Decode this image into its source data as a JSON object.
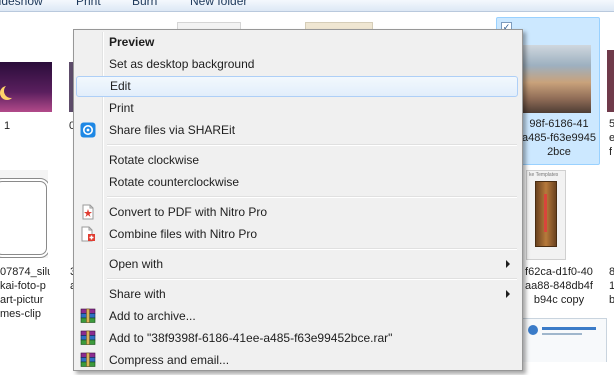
{
  "toolbar": {
    "items": [
      "Slideshow",
      "Print",
      "Burn",
      "New folder"
    ]
  },
  "files": [
    {
      "name_lines": [
        "1"
      ]
    },
    {
      "name_lines": [
        "07874_silu",
        "kai-foto-p",
        "art-pictur",
        "mes-clip"
      ]
    },
    {
      "name_lines": [
        "3",
        "a"
      ]
    },
    {
      "name_lines": [
        "0"
      ]
    },
    {
      "name_lines": [
        "98f-6186-41",
        "a485-f63e9945",
        "2bce"
      ]
    },
    {
      "name_lines": [
        "f62ca-d1f0-40",
        "aa88-848db4f",
        "b94c copy"
      ]
    },
    {
      "name_lines": [
        "5",
        "e",
        "f"
      ]
    },
    {
      "name_lines": [
        "8",
        "1",
        "b"
      ]
    }
  ],
  "thumb_caption": "ke Templates",
  "menu": {
    "items": [
      {
        "label": "Preview",
        "bold": true
      },
      {
        "label": "Set as desktop background"
      },
      {
        "label": "Edit",
        "highlighted": true
      },
      {
        "label": "Print"
      },
      {
        "label": "Share files via SHAREit",
        "icon": "shareit-icon"
      },
      {
        "label": "Rotate clockwise"
      },
      {
        "label": "Rotate counterclockwise"
      },
      {
        "label": "Convert to PDF with Nitro Pro",
        "icon": "nitro-convert-icon"
      },
      {
        "label": "Combine files with Nitro Pro",
        "icon": "nitro-combine-icon"
      },
      {
        "label": "Open with",
        "submenu": true
      },
      {
        "label": "Share with",
        "submenu": true
      },
      {
        "label": "Add to archive...",
        "icon": "winrar-icon"
      },
      {
        "label": "Add to \"38f9398f-6186-41ee-a485-f63e99452bce.rar\"",
        "icon": "winrar-icon"
      },
      {
        "label": "Compress and email...",
        "icon": "winrar-icon"
      }
    ]
  },
  "colors": {
    "selection": "#cce8ff",
    "menu_bg": "#f0f0f0",
    "highlight_border": "#aecff7",
    "shareit_blue": "#1e88e5",
    "nitro_red": "#e03c31"
  }
}
